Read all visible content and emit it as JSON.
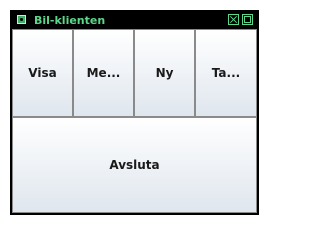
{
  "window": {
    "title": "Bil-klienten"
  },
  "buttons": {
    "visa": "Visa",
    "me": "Me...",
    "ny": "Ny",
    "ta": "Ta...",
    "avsluta": "Avsluta"
  },
  "icons": {
    "app": "app-icon",
    "close": "close-icon",
    "maximize": "maximize-icon"
  }
}
